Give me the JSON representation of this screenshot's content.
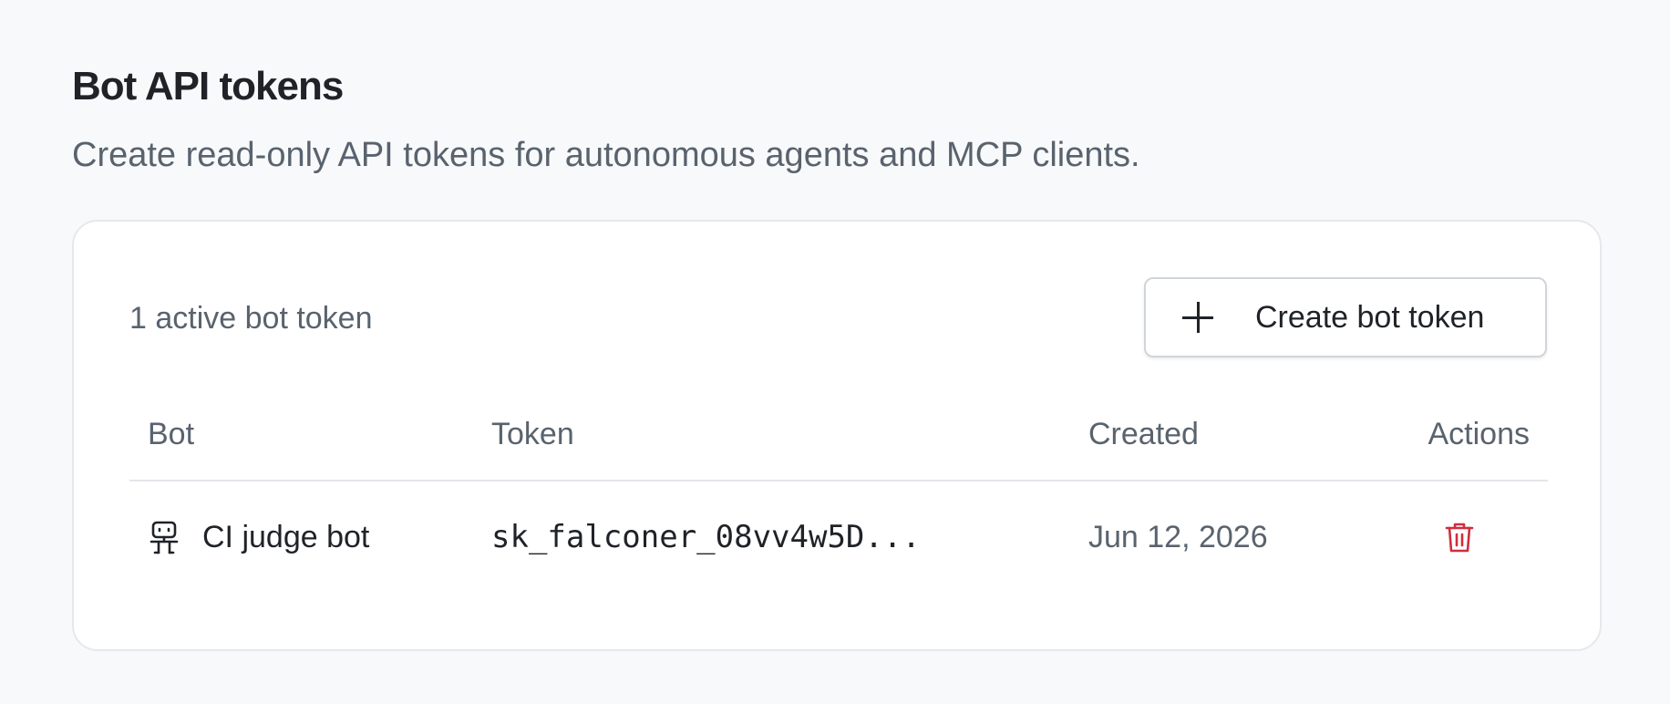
{
  "page": {
    "title": "Bot API tokens",
    "subtitle": "Create read-only API tokens for autonomous agents and MCP clients."
  },
  "card": {
    "count_text": "1 active bot token",
    "create_button_label": "Create bot token",
    "create_button_icon": "plus-icon"
  },
  "table": {
    "columns": [
      "Bot",
      "Token",
      "Created",
      "Actions"
    ],
    "rows": [
      {
        "bot_icon": "robot-icon",
        "bot": "CI judge bot",
        "token": "sk_falconer_08vv4w5D...",
        "created": "Jun 12, 2026",
        "action_icon": "trash-icon"
      }
    ]
  },
  "colors": {
    "background": "#f8f9fb",
    "card": "#ffffff",
    "text_primary": "#1f2328",
    "text_secondary": "#59636e",
    "danger": "#cf2e3d"
  }
}
